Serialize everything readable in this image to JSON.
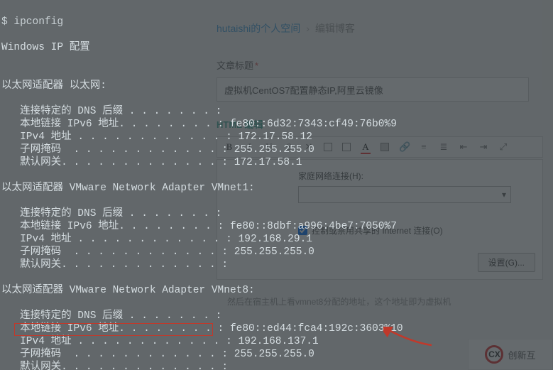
{
  "editor": {
    "breadcrumb_user": "hutaishi",
    "breadcrumb_suffix": "的个人空间",
    "breadcrumb_sep": "›",
    "breadcrumb_current": "编辑博客",
    "title_label": "文章标题",
    "required_mark": "*",
    "title_value": "虚拟机CentOS7配置静态IP,阿里云镜像",
    "html_label": "HTML 编辑",
    "dialog_home_label": "家庭网络连接(H):",
    "dialog_combo_arrow": "▾",
    "dialog_checkbox_label": "控制或禁用共享的 Internet 连接(O)",
    "settings_btn": "设置(G)...",
    "body_text": "然后在宿主机上看vmnet8分配的地址，这个地址即为虚拟机"
  },
  "logo": {
    "mark": "CX",
    "text": "创新互"
  },
  "terminal": {
    "cmd": "$ ipconfig",
    "header": "Windows IP 配置",
    "adapters": [
      {
        "title": "以太网适配器 以太网:",
        "dns": "   连接特定的 DNS 后缀 . . . . . . . :",
        "ipv6l": "   本地链接 IPv6 地址. . . . . . . . :",
        "ipv6v": "fe80::6d32:7343:cf49:76b0%9",
        "ipv4l": "   IPv4 地址 . . . . . . . . . . . . :",
        "ipv4v": "172.17.58.12",
        "maskl": "   子网掩码  . . . . . . . . . . . . :",
        "maskv": "255.255.255.0",
        "gwl": "   默认网关. . . . . . . . . . . . . :",
        "gwv": "172.17.58.1"
      },
      {
        "title": "以太网适配器 VMware Network Adapter VMnet1:",
        "dns": "   连接特定的 DNS 后缀 . . . . . . . :",
        "ipv6l": "   本地链接 IPv6 地址. . . . . . . . :",
        "ipv6v": "fe80::8dbf:a996:4be7:7050%7",
        "ipv4l": "   IPv4 地址 . . . . . . . . . . . . :",
        "ipv4v": "192.168.29.1",
        "maskl": "   子网掩码  . . . . . . . . . . . . :",
        "maskv": "255.255.255.0",
        "gwl": "   默认网关. . . . . . . . . . . . . :",
        "gwv": ""
      },
      {
        "title": "以太网适配器 VMware Network Adapter VMnet8:",
        "dns": "   连接特定的 DNS 后缀 . . . . . . . :",
        "ipv6l": "   本地链接 IPv6 地址. . . . . . . . :",
        "ipv6v": "fe80::ed44:fca4:192c:3603%10",
        "ipv4l": "   IPv4 地址 . . . . . . . . . . . . :",
        "ipv4v": "192.168.137.1",
        "maskl": "   子网掩码  . . . . . . . . . . . . :",
        "maskv": "255.255.255.0",
        "gwl": "   默认网关. . . . . . . . . . . . . :",
        "gwv": ""
      }
    ]
  }
}
